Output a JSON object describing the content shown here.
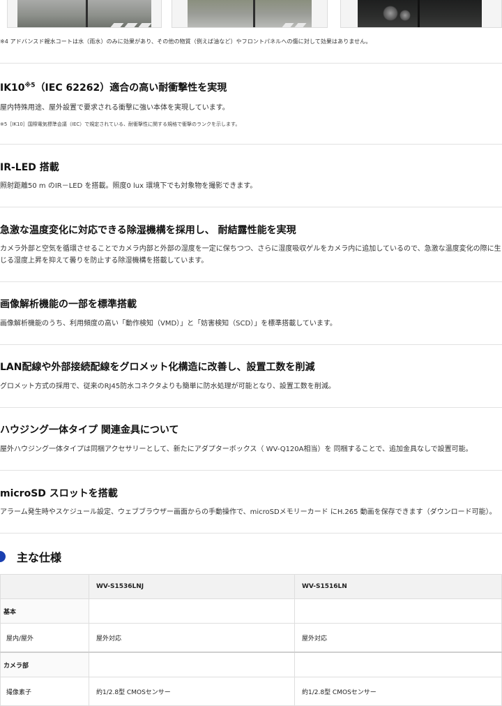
{
  "note4": "※4 アドバンスド親水コートは水（雨水）のみに効果があり、その他の物質（例えば油など）やフロントパネルへの傷に対して効果はありません。",
  "sections": [
    {
      "title_main": "IK10",
      "title_sup": "※5",
      "title_rest": "（IEC 62262）適合の高い耐衝撃性を実現",
      "body": "屋内特殊用途、屋外設置で要求される衝撃に強い本体を実現しています。",
      "note": "※5［IK10］国際電気標準会議（IEC）で規定されている、耐衝撃性に関する規格で衝撃のランクを示します。"
    },
    {
      "title": "IR-LED 搭載",
      "body": "照射距離50 m のIR－LED を搭載。照度0 lux 環境下でも対象物を撮影できます。"
    },
    {
      "title": "急激な温度変化に対応できる除湿機構を採用し、 耐結露性能を実現",
      "body": "カメラ外部と空気を循環させることでカメラ内部と外部の湿度を一定に保ちつつ、さらに湿度吸収ゲルをカメラ内に追加しているので、急激な温度変化の際に生じる湿度上昇を抑えて曇りを防止する除湿機構を搭載しています。"
    },
    {
      "title": "画像解析機能の一部を標準搭載",
      "body": "画像解析機能のうち、利用頻度の高い「動作検知（VMD）」と「妨害検知（SCD）」を標準搭載しています。"
    },
    {
      "title": "LAN配線や外部接続配線をグロメット化構造に改善し、設置工数を削減",
      "body": "グロメット方式の採用で、従来のRJ45防水コネクタよりも簡単に防水処理が可能となり、設置工数を削減。"
    },
    {
      "title": "ハウジング一体タイプ 関連金具について",
      "body": "屋外ハウジング一体タイプは同梱アクセサリーとして、新たにアダプターボックス（ WV-Q120A相当）を 同梱することで、追加金具なしで設置可能。"
    },
    {
      "title": "microSD スロットを搭載",
      "body": "アラーム発生時やスケジュール設定、ウェブブラウザー画面からの手動操作で、microSDメモリーカード にH.265 動画を保存できます（ダウンロード可能）。"
    }
  ],
  "specs": {
    "heading": "主な仕様",
    "columns": [
      "",
      "WV-S1536LNJ",
      "WV-S1516LN"
    ],
    "rows": [
      {
        "type": "group",
        "label": "基本",
        "v1": "",
        "v2": ""
      },
      {
        "type": "item",
        "label": "屋内/屋外",
        "v1": "屋外対応",
        "v2": "屋外対応"
      },
      {
        "type": "group",
        "label": "カメラ部",
        "v1": "",
        "v2": ""
      },
      {
        "type": "item",
        "label": "撮像素子",
        "v1": "約1/2.8型 CMOSセンサー",
        "v2": "約1/2.8型 CMOSセンサー"
      }
    ]
  },
  "colors": {
    "accent": "#1a3fb0"
  }
}
